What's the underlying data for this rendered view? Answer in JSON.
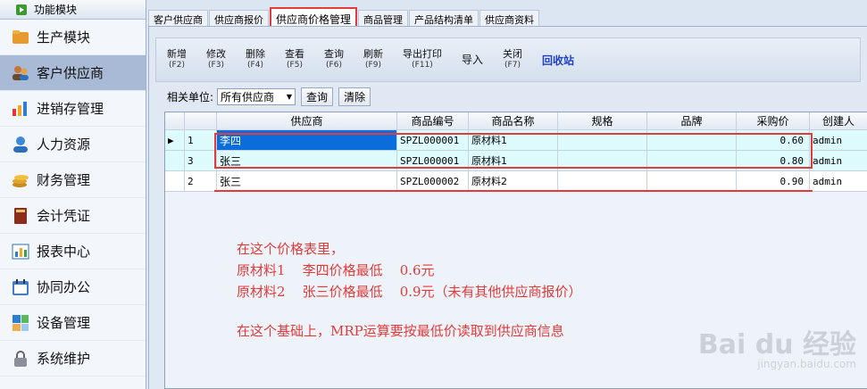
{
  "sidebar": {
    "header": "功能模块",
    "items": [
      {
        "label": "生产模块",
        "icon": "folder-icon",
        "active": false
      },
      {
        "label": "客户供应商",
        "icon": "users-icon",
        "active": true
      },
      {
        "label": "进销存管理",
        "icon": "bar-chart-icon",
        "active": false
      },
      {
        "label": "人力资源",
        "icon": "person-icon",
        "active": false
      },
      {
        "label": "财务管理",
        "icon": "coins-icon",
        "active": false
      },
      {
        "label": "会计凭证",
        "icon": "book-icon",
        "active": false
      },
      {
        "label": "报表中心",
        "icon": "report-icon",
        "active": false
      },
      {
        "label": "协同办公",
        "icon": "calendar-icon",
        "active": false
      },
      {
        "label": "设备管理",
        "icon": "device-icon",
        "active": false
      },
      {
        "label": "系统维护",
        "icon": "lock-icon",
        "active": false
      }
    ]
  },
  "tabs": [
    "客户供应商",
    "供应商报价",
    "供应商价格管理",
    "商品管理",
    "产品结构清单",
    "供应商资料"
  ],
  "toolbar": {
    "buttons": [
      {
        "label": "新增",
        "key": "(F2)"
      },
      {
        "label": "修改",
        "key": "(F3)"
      },
      {
        "label": "删除",
        "key": "(F4)"
      },
      {
        "label": "查看",
        "key": "(F5)"
      },
      {
        "label": "查询",
        "key": "(F6)"
      },
      {
        "label": "刷新",
        "key": "(F9)"
      },
      {
        "label": "导出打印",
        "key": "(F11)"
      },
      {
        "label": "导入",
        "key": ""
      },
      {
        "label": "关闭",
        "key": "(F7)"
      }
    ],
    "recycle": "回收站"
  },
  "filter": {
    "label": "相关单位:",
    "select_value": "所有供应商",
    "query": "查询",
    "clear": "清除"
  },
  "grid": {
    "headers": [
      "",
      "",
      "供应商",
      "商品编号",
      "商品名称",
      "规格",
      "品牌",
      "采购价",
      "创建人"
    ],
    "rows": [
      {
        "marker": "▶",
        "no": "1",
        "supplier": "李四",
        "code": "SPZL000001",
        "name": "原材料1",
        "spec": "",
        "brand": "",
        "price": "0.60",
        "creator": "admin"
      },
      {
        "marker": "",
        "no": "3",
        "supplier": "张三",
        "code": "SPZL000001",
        "name": "原材料1",
        "spec": "",
        "brand": "",
        "price": "0.80",
        "creator": "admin"
      },
      {
        "marker": "",
        "no": "2",
        "supplier": "张三",
        "code": "SPZL000002",
        "name": "原材料2",
        "spec": "",
        "brand": "",
        "price": "0.90",
        "creator": "admin"
      }
    ]
  },
  "note": {
    "line1": "在这个价格表里，",
    "line2": "原材料1    李四价格最低    0.6元",
    "line3": "原材料2    张三价格最低    0.9元（未有其他供应商报价）",
    "line4": "在这个基础上，MRP运算要按最低价读取到供应商信息"
  },
  "watermark": {
    "brand": "Bai du 经验",
    "url": "jingyan.baidu.com"
  },
  "colors": {
    "annotation": "#e13b3b",
    "selection": "#0a6ddb",
    "sidebar_active": "#a8bad6"
  }
}
